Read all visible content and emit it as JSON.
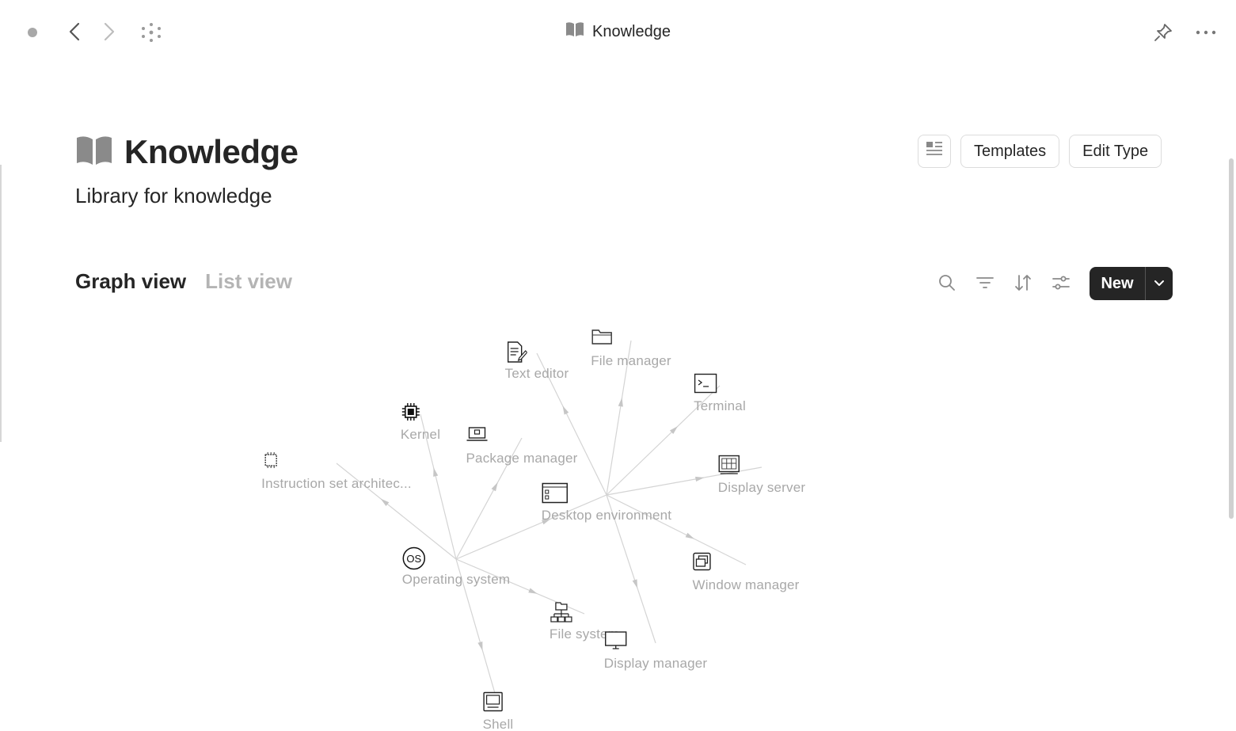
{
  "topbar": {
    "title": "Knowledge",
    "title_icon": "book-open-icon",
    "icons": [
      "window-dot-icon",
      "chevron-left-icon",
      "chevron-right-icon",
      "graph-dots-icon",
      "pin-icon",
      "more-horizontal-icon"
    ]
  },
  "header": {
    "title": "Knowledge",
    "title_icon": "book-open-icon",
    "subtitle": "Library for knowledge",
    "layout_icon": "layout-list-icon",
    "templates_label": "Templates",
    "edit_type_label": "Edit Type"
  },
  "views": {
    "graph_label": "Graph view",
    "list_label": "List view",
    "active": "graph"
  },
  "toolbar": {
    "icons": [
      "search-icon",
      "filter-icon",
      "sort-icon",
      "settings-sliders-icon"
    ],
    "new_label": "New",
    "new_dropdown_icon": "chevron-down-icon"
  },
  "graph": {
    "nodes": {
      "os": {
        "label": "Operating system",
        "icon": "os-circle-icon"
      },
      "kernel": {
        "label": "Kernel",
        "icon": "chip-icon"
      },
      "isa": {
        "label": "Instruction set architec...",
        "icon": "cpu-outline-icon"
      },
      "pkg": {
        "label": "Package manager",
        "icon": "laptop-icon"
      },
      "text": {
        "label": "Text editor",
        "icon": "document-edit-icon"
      },
      "file": {
        "label": "File manager",
        "icon": "folder-icon"
      },
      "term": {
        "label": "Terminal",
        "icon": "terminal-icon"
      },
      "dserver": {
        "label": "Display server",
        "icon": "display-grid-icon"
      },
      "de": {
        "label": "Desktop environment",
        "icon": "window-icon"
      },
      "wm": {
        "label": "Window manager",
        "icon": "windows-stack-icon"
      },
      "fs": {
        "label": "File system",
        "icon": "folder-tree-icon"
      },
      "dm": {
        "label": "Display manager",
        "icon": "monitor-icon"
      },
      "shell": {
        "label": "Shell",
        "icon": "shell-monitor-icon"
      }
    },
    "edges": [
      [
        "os",
        "kernel"
      ],
      [
        "os",
        "isa"
      ],
      [
        "os",
        "pkg"
      ],
      [
        "os",
        "de"
      ],
      [
        "os",
        "fs"
      ],
      [
        "os",
        "shell"
      ],
      [
        "de",
        "text"
      ],
      [
        "de",
        "file"
      ],
      [
        "de",
        "term"
      ],
      [
        "de",
        "dserver"
      ],
      [
        "de",
        "wm"
      ],
      [
        "de",
        "dm"
      ]
    ]
  },
  "colors": {
    "text": "#252525",
    "muted": "#a8a8a8",
    "edge": "#d4d4d4",
    "primary_button": "#252525"
  }
}
